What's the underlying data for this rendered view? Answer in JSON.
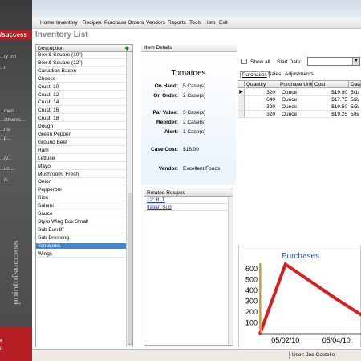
{
  "brand": "/success",
  "sidebar_items": [
    "...ry Inft",
    "...n",
    "...ment...",
    "...stments...",
    "...nts",
    "...p...",
    "...ry...",
    "...unt...",
    "...ls..."
  ],
  "sidebar_vertical": "pointofsuccess",
  "sidebar_bottom": [
    "e",
    "0"
  ],
  "menu": [
    "Home",
    "Inventory",
    "Recipes",
    "Purchase Orders",
    "Vendors",
    "Reports",
    "Tools",
    "Help",
    "Exit"
  ],
  "page_title": "Inventory List",
  "list": {
    "header": "Description",
    "items": [
      "Box & Square (10\")",
      "Box & Square (12\")",
      "Canadian Bacon",
      "Cheese",
      "Crust, 10",
      "Crust, 12",
      "Crust, 14",
      "Crust, 16",
      "Crust, 18",
      "Dough",
      "Green Pepper",
      "Ground Beef",
      "Ham",
      "Lettuce",
      "Mayo",
      "Mushroom, Fresh",
      "Onion",
      "Pepperoni",
      "Ribs",
      "Salami",
      "Sauce",
      "Styro Wing Box Small",
      "Sub Bun 8\"",
      "Sub Dressing",
      "Tomatoes",
      "Wings"
    ],
    "selected_index": 24
  },
  "details": {
    "tab": "Item Details",
    "name": "Tomatoes",
    "fields": [
      {
        "label": "On Hand:",
        "value": "5 Case(s)"
      },
      {
        "label": "On Order:",
        "value": "2 Case(s)"
      },
      {
        "label": "Par Value:",
        "value": "3 Case(s)"
      },
      {
        "label": "Reorder:",
        "value": "2 Case(s)"
      },
      {
        "label": "Alert:",
        "value": "1 Case(s)"
      },
      {
        "label": "Case Cost:",
        "value": "$16.00"
      },
      {
        "label": "Vendor:",
        "value": "Excellent Foods"
      }
    ]
  },
  "recipes": {
    "header": "Related Recipes",
    "items": [
      "12\" BLT",
      "Italian Sub"
    ]
  },
  "filter": {
    "show_all": "Show all",
    "start_date_label": "Start Date:"
  },
  "tabs": [
    "Purchases",
    "Sales",
    "Adjustments"
  ],
  "grid": {
    "columns": [
      "Quantity",
      "Purchase Unit",
      "Cost",
      "Date"
    ],
    "rows": [
      [
        "320",
        "Ounce",
        "$19.90",
        "5/1/"
      ],
      [
        "640",
        "Ounce",
        "$17.75",
        "5/2/"
      ],
      [
        "320",
        "Ounce",
        "$19.50",
        "5/3/"
      ],
      [
        "320",
        "Ounce",
        "$19.25",
        "5/6/"
      ]
    ]
  },
  "chart_data": {
    "type": "line",
    "title": "Purchases",
    "y_ticks": [
      600,
      500,
      400,
      300,
      200,
      100
    ],
    "x_ticks": [
      "05/02/10",
      "05/04/10"
    ],
    "x": [
      "05/01/10",
      "05/02/10",
      "05/03/10",
      "05/04/10",
      "05/05/10"
    ],
    "series": [
      {
        "values": [
          0,
          640,
          480,
          320,
          170
        ]
      }
    ],
    "ylim": [
      0,
      650
    ],
    "line_color": "#d62020",
    "grid": false
  },
  "status": {
    "user": "User: Joe Costello"
  }
}
